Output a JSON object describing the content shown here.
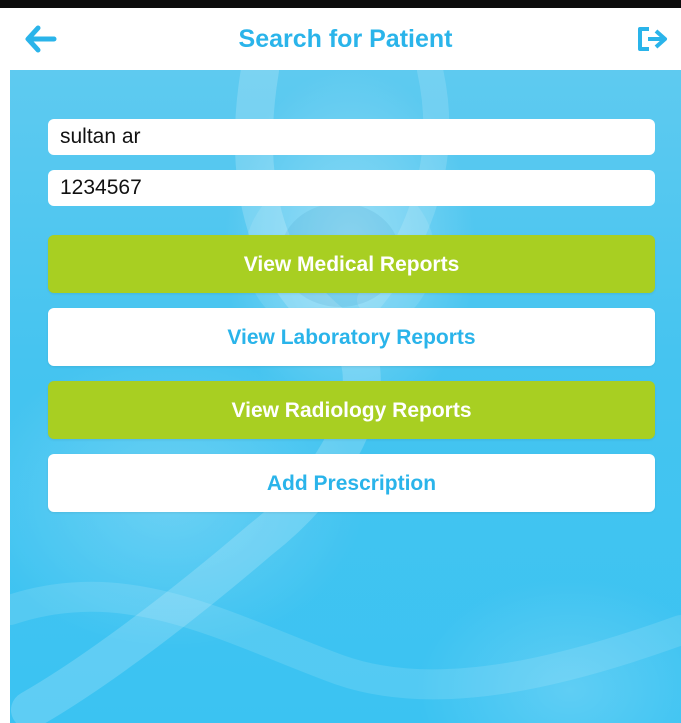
{
  "header": {
    "title": "Search for Patient",
    "back_icon": "arrow-left-icon",
    "logout_icon": "logout-icon",
    "accent_color": "#2ab4ea"
  },
  "search": {
    "patient_name_value": "sultan ar",
    "patient_id_value": "1234567"
  },
  "actions": {
    "medical_reports_label": "View Medical Reports",
    "laboratory_reports_label": "View Laboratory Reports",
    "radiology_reports_label": "View Radiology Reports",
    "add_prescription_label": "Add Prescription"
  },
  "colors": {
    "primary_button": "#a8cf22",
    "secondary_button": "#ffffff",
    "background": "#45c4f0"
  }
}
